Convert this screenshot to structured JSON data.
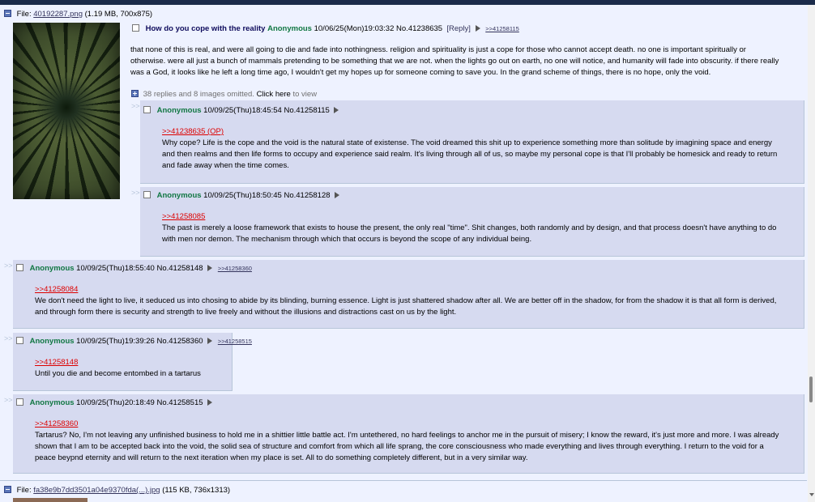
{
  "op": {
    "file_label": "File:",
    "file_name": "40192287.png",
    "file_info": "(1.19 MB, 700x875)",
    "subject": "How do you cope with the reality",
    "name": "Anonymous",
    "datetime": "10/06/25(Mon)19:03:32",
    "number": "No.41238635",
    "reply_label": "[Reply]",
    "backlink": ">>41258115",
    "text": "that none of this is real, and were all going to die and fade into nothingness. religion and spirituality is just a cope for those who cannot accept death. no one is important spiritually or otherwise. were all just a bunch of mammals pretending to be something that we are not. when the lights go out on earth, no one will notice, and humanity will fade into obscurity. if there really was a God, it looks like he left a long time ago, I wouldn't get my hopes up for someone coming to save you. In the grand scheme of things, there is no hope, only the void.",
    "omitted": "38 replies and 8 images omitted.",
    "click_here": "Click here",
    "to_view": "to view"
  },
  "replies": [
    {
      "name": "Anonymous",
      "datetime": "10/09/25(Thu)18:45:54",
      "number": "No.41258115",
      "backlink": "",
      "quote": ">>41238635 (OP)",
      "text": "Why cope? Life is the cope and the void is the natural state of existense. The void dreamed this shit up to experience something more than solitude by imagining space and energy and then realms and then life forms to occupy and experience said realm. It's living through all of us, so maybe my personal cope is that I'll probably be homesick and ready to return and fade away when the time comes."
    },
    {
      "name": "Anonymous",
      "datetime": "10/09/25(Thu)18:50:45",
      "number": "No.41258128",
      "backlink": "",
      "quote": ">>41258085",
      "text": "The past is merely a loose framework that exists to house the present, the only real \"time\". Shit changes, both randomly and by design, and that process doesn't have anything to do with men nor demon. The mechanism through which that occurs is beyond the scope of any individual being."
    },
    {
      "name": "Anonymous",
      "datetime": "10/09/25(Thu)18:55:40",
      "number": "No.41258148",
      "backlink": ">>41258360",
      "quote": ">>41258084",
      "text": "We don't need the light to live, it seduced us into chosing to abide by its blinding, burning essence. Light is just shattered shadow after all. We are better off in the shadow, for from the shadow it is that all form is derived, and through form there is security and strength to live freely and without the illusions and distractions cast on us by the light."
    },
    {
      "name": "Anonymous",
      "datetime": "10/09/25(Thu)19:39:26",
      "number": "No.41258360",
      "backlink": ">>41258515",
      "quote": ">>41258148",
      "text": "Until you die and become entombed in a tartarus"
    },
    {
      "name": "Anonymous",
      "datetime": "10/09/25(Thu)20:18:49",
      "number": "No.41258515",
      "backlink": "",
      "quote": ">>41258360",
      "text": "Tartarus? No, I'm not leaving any unfinished business to hold me in a shittier little battle act. I'm untethered, no hard feelings to anchor me in the pursuit of misery; I know the reward, it's just more and more. I was already shown that I am to be accepted back into the void, the solid sea of structure and comfort from which all life sprang, the core consciousness who made everything and lives through everything. I return to the void for a peace beypnd eternity and will return to the next iteration when my place is set. All to do something completely different, but in a very similar way."
    }
  ],
  "next_thread": {
    "file_label": "File:",
    "file_name": "fa38e9b7dd3501a04e9370fda(...).jpg",
    "file_info": "(115 KB, 736x1313)"
  },
  "side_arrows": ">>"
}
